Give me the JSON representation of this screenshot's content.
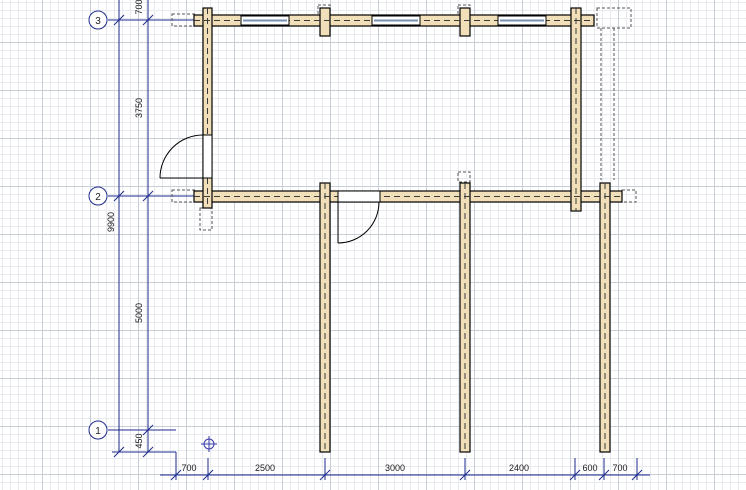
{
  "axes": [
    {
      "label": "3"
    },
    {
      "label": "2"
    },
    {
      "label": "1"
    }
  ],
  "vertical_dims": {
    "top": "700",
    "span_3_2": "3750",
    "total": "9900",
    "span_2_1": "5000",
    "bottom": "450"
  },
  "horizontal_dims": [
    "700",
    "2500",
    "3000",
    "2400",
    "600",
    "700"
  ],
  "colors": {
    "timber": "#f0dfb8",
    "dim_line": "#1c2a8c",
    "outline": "#000000",
    "window": "#cfd8e6"
  }
}
